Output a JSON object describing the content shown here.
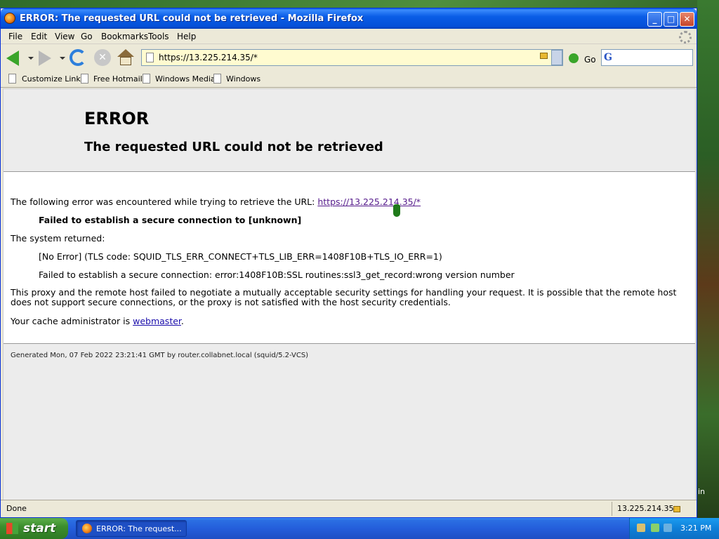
{
  "window": {
    "title": "ERROR: The requested URL could not be retrieved - Mozilla Firefox"
  },
  "menu": [
    "File",
    "Edit",
    "View",
    "Go",
    "Bookmarks",
    "Tools",
    "Help"
  ],
  "navbar": {
    "url": "https://13.225.214.35/*",
    "go_label": "Go"
  },
  "bookmarks": [
    "Customize Links",
    "Free Hotmail",
    "Windows Media",
    "Windows"
  ],
  "page": {
    "heading1": "ERROR",
    "heading2": "The requested URL could not be retrieved",
    "intro": "The following error was encountered while trying to retrieve the URL: ",
    "intro_link": "https://13.225.214.35/*",
    "failed_msg": "Failed to establish a secure connection to [unknown]",
    "system_returned": "The system returned:",
    "tls_code": "[No Error] (TLS code: SQUID_TLS_ERR_CONNECT+TLS_LIB_ERR=1408F10B+TLS_IO_ERR=1)",
    "ssl_error": "Failed to establish a secure connection: error:1408F10B:SSL routines:ssl3_get_record:wrong version number",
    "proxy_explain": "This proxy and the remote host failed to negotiate a mutually acceptable security settings for handling your request. It is possible that the remote host does not support secure connections, or the proxy is not satisfied with the host security credentials.",
    "admin_prefix": "Your cache administrator is ",
    "admin_link": "webmaster",
    "admin_suffix": ".",
    "footer": "Generated Mon, 07 Feb 2022 23:21:41 GMT by router.collabnet.local (squid/5.2-VCS)"
  },
  "status": {
    "left": "Done",
    "right": "13.225.214.35"
  },
  "taskbar": {
    "start": "start",
    "task_label": "ERROR: The request...",
    "clock": "3:21 PM"
  },
  "desktop": {
    "edge_text": "in"
  }
}
